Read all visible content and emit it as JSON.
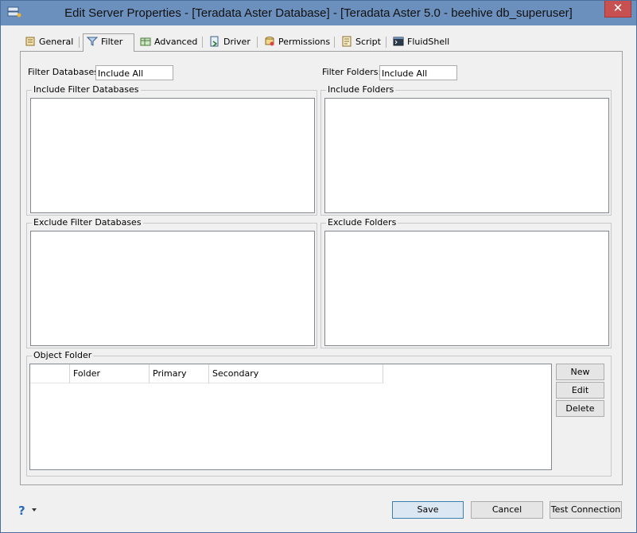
{
  "window": {
    "title": "Edit Server Properties - [Teradata Aster Database] - [Teradata Aster 5.0 - beehive db_superuser]",
    "close_label": "✕"
  },
  "tabs": [
    {
      "label": "General",
      "icon": "general-icon"
    },
    {
      "label": "Filter",
      "icon": "filter-icon",
      "active": true
    },
    {
      "label": "Advanced",
      "icon": "advanced-icon"
    },
    {
      "label": "Driver",
      "icon": "driver-icon"
    },
    {
      "label": "Permissions",
      "icon": "permissions-icon"
    },
    {
      "label": "Script",
      "icon": "script-icon"
    },
    {
      "label": "FluidShell",
      "icon": "fluidshell-icon"
    }
  ],
  "filter": {
    "databases_label": "Filter Databases",
    "databases_value": "Include All",
    "folders_label": "Filter Folders:",
    "folders_value": "Include All"
  },
  "groups": {
    "include_databases": "Include Filter Databases",
    "include_folders": "Include Folders",
    "exclude_databases": "Exclude Filter Databases",
    "exclude_folders": "Exclude Folders",
    "object_folder": "Object Folder"
  },
  "object_folder": {
    "columns": [
      "",
      "Folder",
      "Primary",
      "Secondary"
    ],
    "rows": [],
    "new_label": "New",
    "edit_label": "Edit",
    "delete_label": "Delete"
  },
  "footer": {
    "help_label": "?",
    "save_label": "Save",
    "cancel_label": "Cancel",
    "test_label": "Test Connection"
  },
  "colors": {
    "titlebar": "#6c90bd",
    "close": "#c75050",
    "dialog_bg": "#f0f0f0",
    "primary_button_border": "#3c7fb1"
  }
}
